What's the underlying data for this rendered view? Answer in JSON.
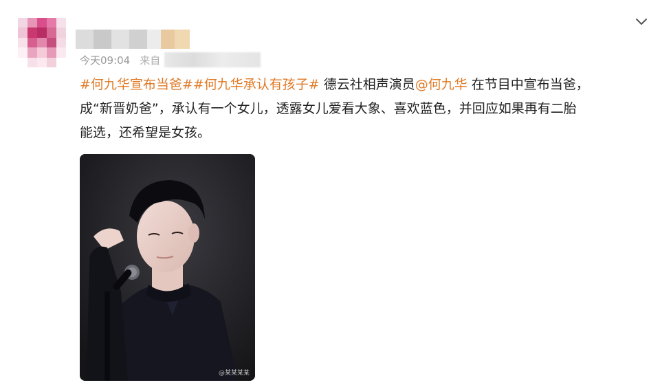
{
  "post": {
    "time": "今天09:04",
    "source_prefix": "来自",
    "hashtag_1": "#何九华宣布当爸#",
    "hashtag_2": "#何九华承认有孩子#",
    "text_part_1": " 德云社相声演员",
    "mention": "@何九华",
    "text_part_2": " 在节目中宣布当爸，",
    "line_2": "成“新晋奶爸”，承认有一个女儿，透露女儿爱看大象、喜欢蓝色，并回应如果再有二胎",
    "line_3": "能选，还希望是女孩。",
    "photo_watermark": "@某某某某"
  },
  "icons": {
    "menu": "chevron-down-icon"
  },
  "colors": {
    "link": "#e07a26",
    "text": "#222222",
    "meta": "#9a9a9a"
  }
}
